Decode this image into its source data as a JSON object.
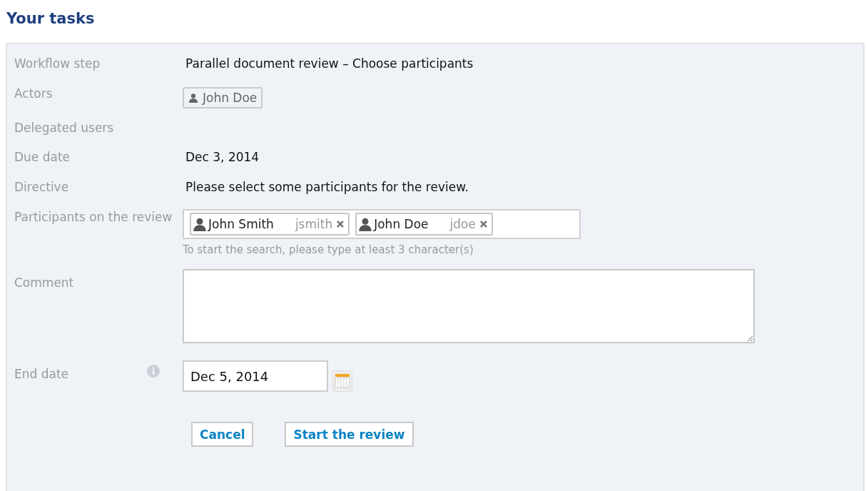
{
  "title": "Your tasks",
  "fields": [
    {
      "kind": "text",
      "label": "Workflow step",
      "value": "Parallel document review – Choose participants"
    },
    {
      "kind": "users",
      "label": "Actors",
      "users": [
        {
          "name": "John Doe"
        }
      ]
    },
    {
      "kind": "empty",
      "label": "Delegated users"
    },
    {
      "kind": "text",
      "label": "Due date",
      "value": "Dec 3, 2014"
    },
    {
      "kind": "text",
      "label": "Directive",
      "value": "Please select some participants for the review."
    },
    {
      "kind": "participants",
      "label": "Participants on the review",
      "participants": [
        {
          "name": "John Smith",
          "username": "jsmith"
        },
        {
          "name": "John Doe",
          "username": "jdoe"
        }
      ],
      "help": "To start the search, please type at least 3 character(s)"
    },
    {
      "kind": "textarea",
      "label": "Comment"
    },
    {
      "kind": "date",
      "label": "End date",
      "value": "Dec 5, 2014"
    }
  ],
  "buttons": [
    "Cancel",
    "Start the review"
  ]
}
